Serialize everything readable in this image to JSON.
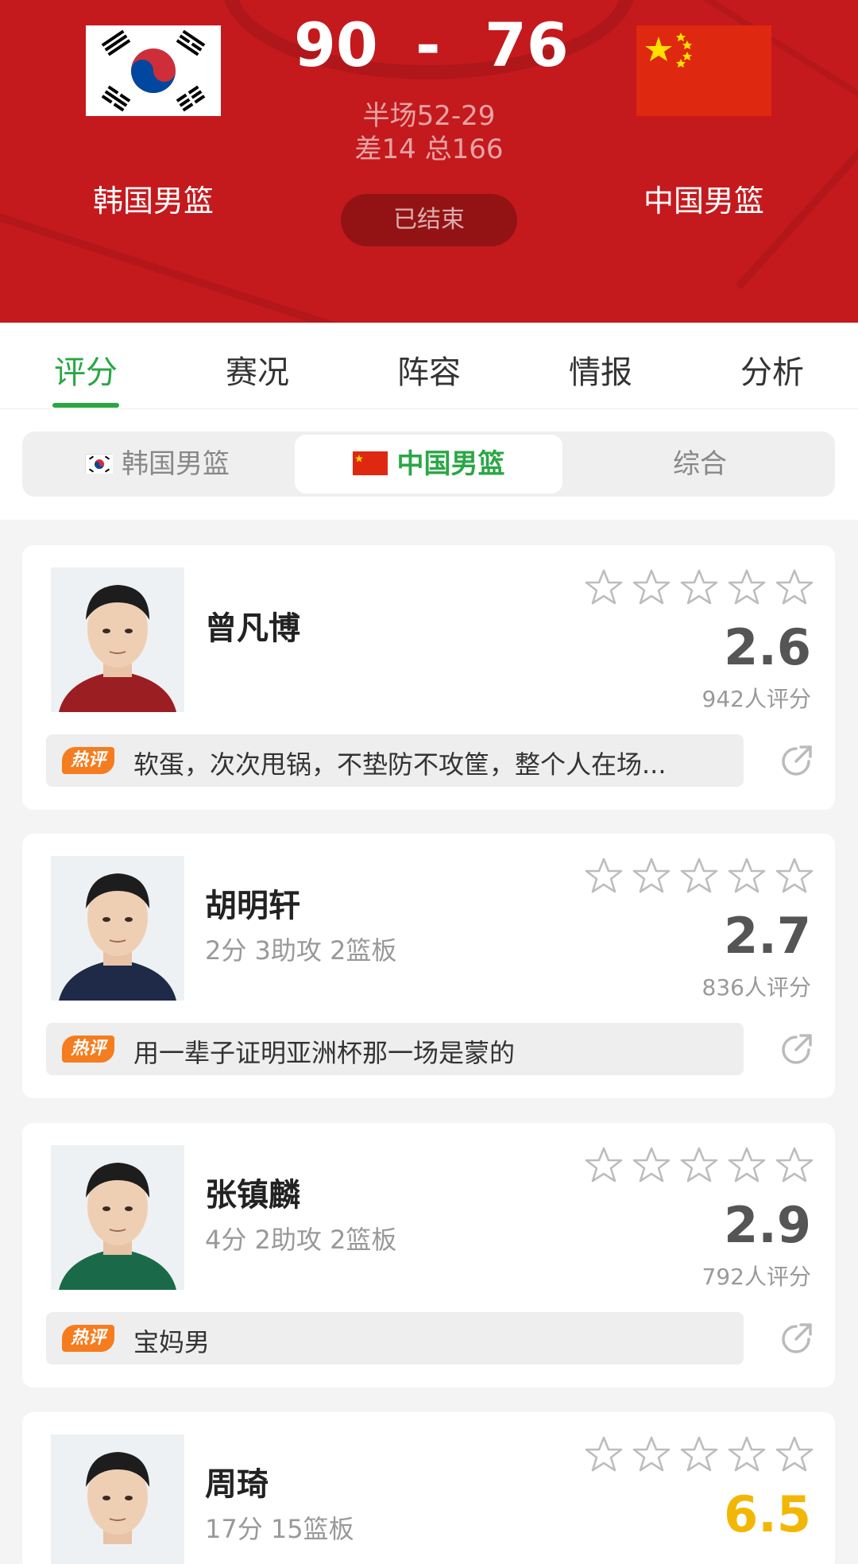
{
  "match": {
    "home_team": "韩国男篮",
    "away_team": "中国男篮",
    "home_score": "90",
    "separator": "-",
    "away_score": "76",
    "half_score": "半场52-29",
    "diff_total": "差14 总166",
    "status": "已结束"
  },
  "tabs": [
    "评分",
    "赛况",
    "阵容",
    "情报",
    "分析"
  ],
  "active_tab": "评分",
  "segment": {
    "home": "韩国男篮",
    "away": "中国男篮",
    "combined": "综合",
    "active": "中国男篮"
  },
  "hot_badge_label": "热评",
  "players": [
    {
      "name": "曾凡博",
      "stats": "",
      "rating": "2.6",
      "rating_count": "942人评分",
      "comment": "软蛋，次次甩锅，不垫防不攻筐，整个人在场..."
    },
    {
      "name": "胡明轩",
      "stats": "2分 3助攻 2篮板",
      "rating": "2.7",
      "rating_count": "836人评分",
      "comment": "用一辈子证明亚洲杯那一场是蒙的"
    },
    {
      "name": "张镇麟",
      "stats": "4分 2助攻 2篮板",
      "rating": "2.9",
      "rating_count": "792人评分",
      "comment": "宝妈男"
    },
    {
      "name": "周琦",
      "stats": "17分 15篮板",
      "rating": "6.5",
      "rating_count": "",
      "comment": ""
    }
  ],
  "colors": {
    "header_red": "#c41a1d",
    "accent_green": "#2aa745",
    "hot_orange": "#f57c1f",
    "rating_gold": "#f2b705"
  }
}
